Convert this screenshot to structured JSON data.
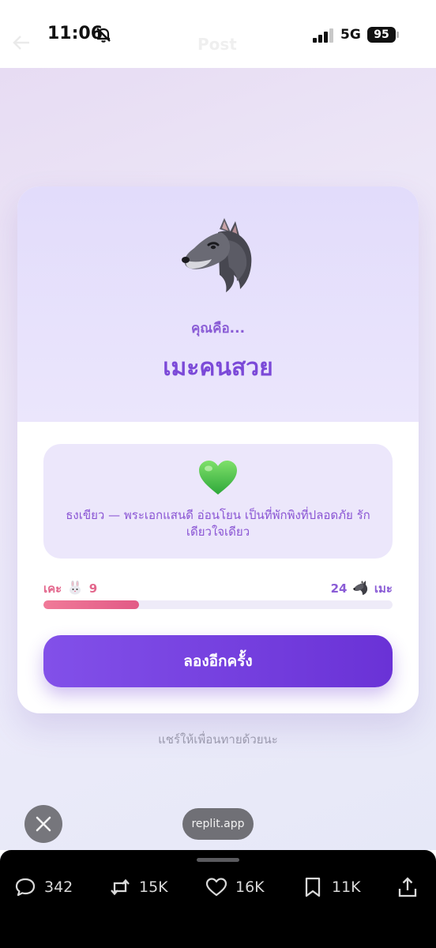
{
  "status_bar": {
    "time": "11:06",
    "network": "5G",
    "battery": "95"
  },
  "header": {
    "title": "Post"
  },
  "quiz_result": {
    "prompt": "คุณคือ...",
    "result_name": "เมะคนสวย",
    "result_icon": "wolf-emoji",
    "trait_icon": "green-heart-emoji",
    "description": "ธงเขียว — พระเอกแสนดี อ่อนโยน เป็นที่พักพิงที่ปลอดภัย รักเดียวใจเดียว",
    "score_left": {
      "label": "เคะ",
      "icon": "rabbit-emoji",
      "value": "9"
    },
    "score_right": {
      "label": "เมะ",
      "icon": "wolf-emoji",
      "value": "24"
    },
    "progress_fraction": 0.273,
    "retry_label": "ลองอีกครั้ง",
    "share_note": "แชร์ให้เพื่อนทายด้วยนะ"
  },
  "overlay": {
    "url": "replit.app"
  },
  "actions": {
    "replies": "342",
    "reposts": "15K",
    "likes": "16K",
    "bookmarks": "11K"
  },
  "colors": {
    "accent_purple": "#7b49d8",
    "progress_pink": "#e25a86",
    "card_top": "#e2dcfb"
  }
}
